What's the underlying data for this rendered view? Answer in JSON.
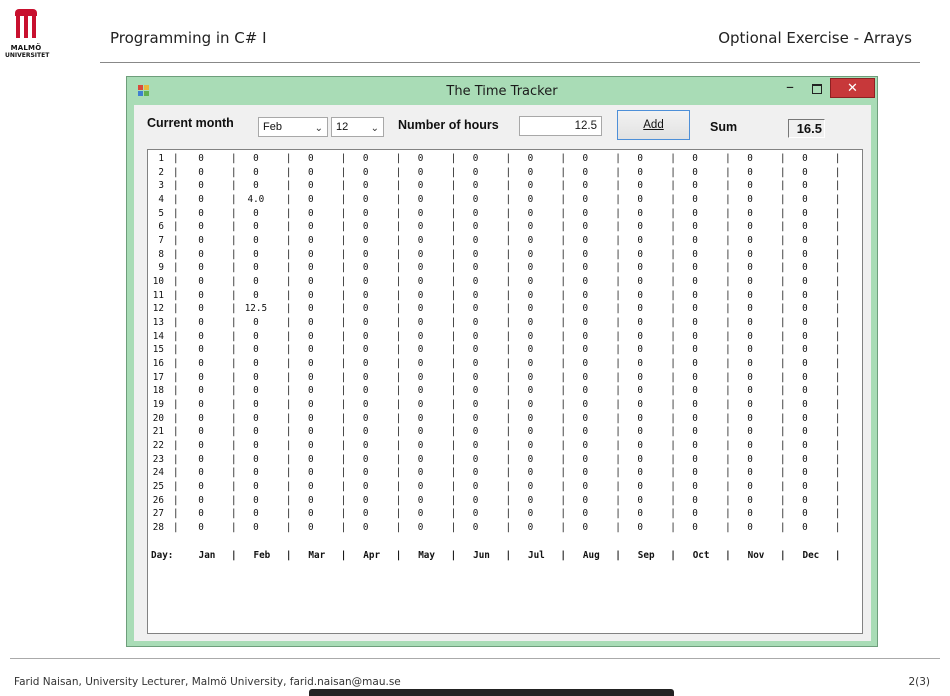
{
  "slide": {
    "logo_line1": "MALMÖ",
    "logo_line2": "UNIVERSITET",
    "course_title": "Programming in C# I",
    "exercise_title": "Optional Exercise - Arrays",
    "footer_text": "Farid Naisan, University Lecturer, Malmö University, farid.naisan@mau.se",
    "page_number": "2(3)"
  },
  "window": {
    "title": "The Time Tracker",
    "minimize_glyph": "–",
    "close_glyph": "✕"
  },
  "form": {
    "current_month_label": "Current month",
    "month_select": {
      "value": "Feb",
      "options": [
        "Jan",
        "Feb",
        "Mar",
        "Apr",
        "May",
        "Jun",
        "Jul",
        "Aug",
        "Sep",
        "Oct",
        "Nov",
        "Dec"
      ]
    },
    "day_select": {
      "value": "12"
    },
    "hours_label": "Number of hours",
    "hours_value": "12.5",
    "add_button": "Add",
    "sum_label": "Sum",
    "sum_value": "16.5"
  },
  "table": {
    "months": [
      "Jan",
      "Feb",
      "Mar",
      "Apr",
      "May",
      "Jun",
      "Jul",
      "Aug",
      "Sep",
      "Oct",
      "Nov",
      "Dec"
    ],
    "day_header": "Day:",
    "days": 28,
    "default_value": "0",
    "entries": [
      {
        "day": 4,
        "month": "Feb",
        "value": "4.0"
      },
      {
        "day": 12,
        "month": "Feb",
        "value": "12.5"
      }
    ]
  },
  "colors": {
    "window_frame": "#a9dcb6",
    "close_button": "#c7383a",
    "logo_red": "#c8102e",
    "hours_text": "#1a1a1a"
  }
}
